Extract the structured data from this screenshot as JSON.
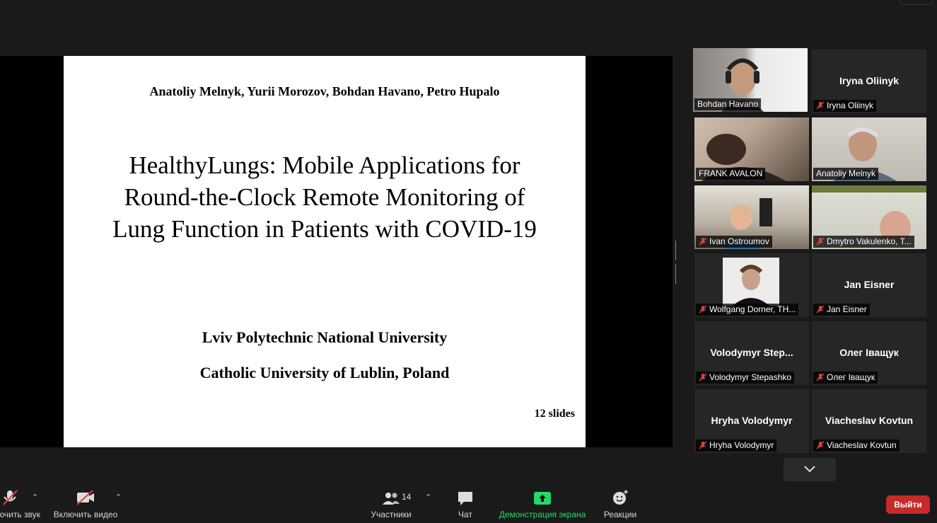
{
  "slide": {
    "authors": "Anatoliy Melnyk, Yurii Morozov, Bohdan Havano, Petro Hupalo",
    "title_lines": [
      "HealthyLungs: Mobile Applications for",
      "Round-the-Clock Remote Monitoring of",
      "Lung Function in Patients with COVID-19"
    ],
    "org1": "Lviv Polytechnic National University",
    "org2": "Catholic University of Lublin, Poland",
    "slide_count": "12 slides"
  },
  "participants": [
    {
      "name": "Bohdan Havano",
      "center": "",
      "video": true,
      "muted": false,
      "active": true
    },
    {
      "name": "Iryna Oliinyk",
      "center": "Iryna Oliinyk",
      "video": false,
      "muted": true
    },
    {
      "name": "FRANK AVALON",
      "center": "",
      "video": true,
      "muted": false
    },
    {
      "name": "Anatoliy Melnyk",
      "center": "",
      "video": true,
      "muted": false
    },
    {
      "name": "Ivan Ostroumov",
      "center": "",
      "video": true,
      "muted": true
    },
    {
      "name": "Dmytro Vakulenko, T...",
      "center": "",
      "video": true,
      "muted": true
    },
    {
      "name": "Wolfgang Dorner, TH...",
      "center": "",
      "video": true,
      "muted": true
    },
    {
      "name": "Jan Eisner",
      "center": "Jan Eisner",
      "video": false,
      "muted": true
    },
    {
      "name": "Volodymyr Stepashko",
      "center": "Volodymyr  Step...",
      "video": false,
      "muted": true
    },
    {
      "name": "Олег Іващук",
      "center": "Олег Іващук",
      "video": false,
      "muted": true
    },
    {
      "name": "Hryha Volodymyr",
      "center": "Hryha Volodymyr",
      "video": false,
      "muted": true
    },
    {
      "name": "Viacheslav Kovtun",
      "center": "Viacheslav Kovtun",
      "video": false,
      "muted": true
    }
  ],
  "toolbar": {
    "audio_label": "ючить звук",
    "video_label": "Включить видео",
    "participants_label": "Участники",
    "participants_count": "14",
    "chat_label": "Чат",
    "share_label": "Демонстрация экрана",
    "reactions_label": "Реакции",
    "leave_label": "Выйти"
  },
  "colors": {
    "active_speaker": "#b9d630",
    "share_green": "#23d96b",
    "leave_red": "#c62a2a",
    "muted_red": "#e0413c"
  }
}
